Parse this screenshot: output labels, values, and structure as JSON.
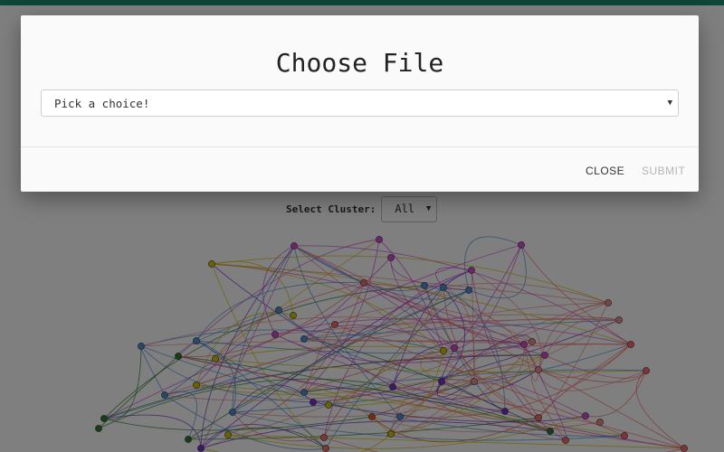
{
  "app": {
    "accent_color": "#1f8a70"
  },
  "cluster_selector": {
    "label": "Select Cluster:",
    "value": "All",
    "caret_icon": "caret-down-icon"
  },
  "modal": {
    "title": "Choose File",
    "file_select": {
      "placeholder": "Pick a choice!",
      "caret_icon": "caret-down-icon"
    },
    "footer": {
      "close_label": "CLOSE",
      "submit_label": "SUBMIT",
      "submit_disabled": true
    }
  },
  "graph": {
    "node_colors": [
      "#4a90d9",
      "#d64bd6",
      "#ff6b6b",
      "#2e7d32",
      "#d4c400",
      "#7b2fd6",
      "#e85a1a",
      "#f28b8b"
    ]
  }
}
